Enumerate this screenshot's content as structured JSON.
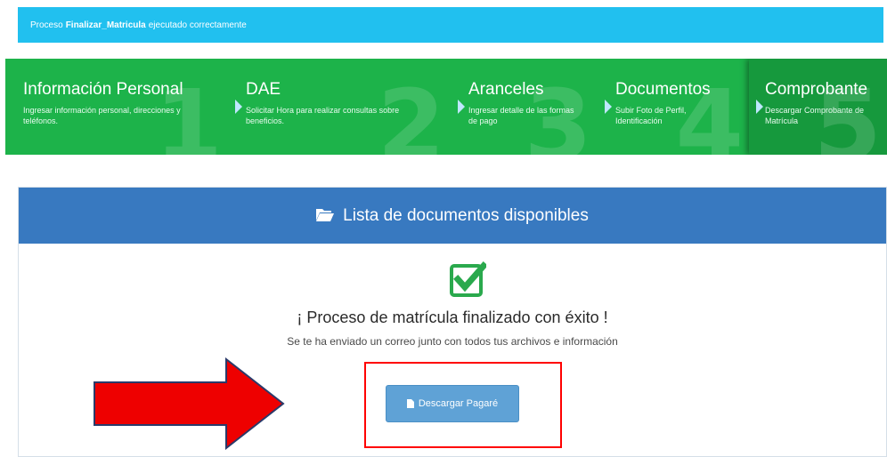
{
  "alert": {
    "prefix": "Proceso",
    "process_name": "Finalizar_Matricula",
    "suffix": "ejecutado correctamente",
    "background": "#21c0ef"
  },
  "steps": [
    {
      "title": "Información Personal",
      "description": "Ingresar información personal, direcciones y teléfonos.",
      "number": "1"
    },
    {
      "title": "DAE",
      "description": "Solicitar Hora para realizar consultas sobre beneficios.",
      "number": "2"
    },
    {
      "title": "Aranceles",
      "description": "Ingresar detalle de las formas de pago",
      "number": "3"
    },
    {
      "title": "Documentos",
      "description": "Subir Foto de Perfil, Identificación",
      "number": "4"
    },
    {
      "title": "Comprobante",
      "description": "Descargar Comprobante de Matrícula",
      "number": "5"
    }
  ],
  "panel": {
    "header_icon": "folder-open-icon",
    "header_title": "Lista de documentos disponibles",
    "success_icon": "checkbox-check-icon",
    "result_title": "¡ Proceso de matrícula finalizado con éxito !",
    "result_subtitle": "Se te ha enviado un correo junto con todos tus archivos e información",
    "download_button": "Descargar Pagaré",
    "download_icon": "file-icon"
  },
  "annotations": {
    "arrow_color": "#ee0000",
    "highlight_color": "#ff0000"
  },
  "colors": {
    "steps_green": "#1db34a",
    "panel_blue": "#3879c0",
    "button_blue": "#5fa2d6",
    "check_green": "#2aa94d"
  }
}
